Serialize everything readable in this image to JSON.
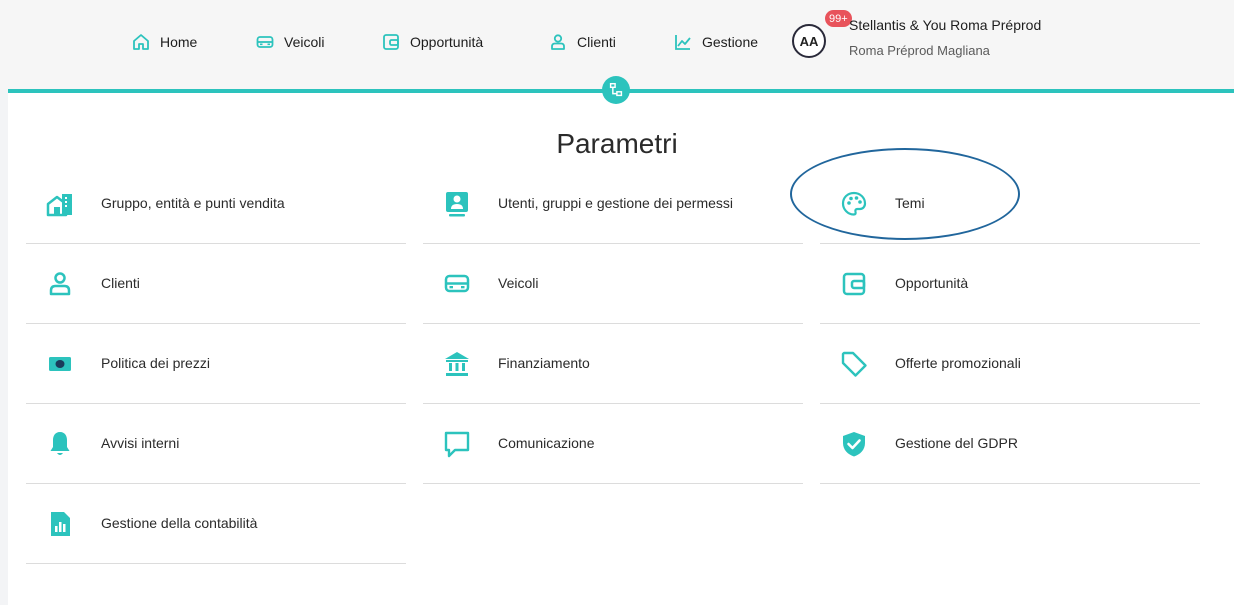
{
  "nav": [
    {
      "label": "Home",
      "icon": "home-icon"
    },
    {
      "label": "Veicoli",
      "icon": "car-icon"
    },
    {
      "label": "Opportunità",
      "icon": "wallet-icon"
    },
    {
      "label": "Clienti",
      "icon": "person-icon"
    },
    {
      "label": "Gestione",
      "icon": "chart-line-icon"
    }
  ],
  "user": {
    "initials": "AA",
    "badge": "99+",
    "name": "Stellantis & You Roma Préprod",
    "location": "Roma Préprod Magliana"
  },
  "page": {
    "title": "Parametri"
  },
  "accent": "#2cc3bd",
  "highlight_color": "#21669c",
  "items": [
    {
      "label": "Gruppo, entità e punti vendita",
      "icon": "buildings-icon"
    },
    {
      "label": "Utenti, gruppi e gestione dei permessi",
      "icon": "user-card-icon"
    },
    {
      "label": "Temi",
      "icon": "palette-icon"
    },
    {
      "label": "Clienti",
      "icon": "person-icon"
    },
    {
      "label": "Veicoli",
      "icon": "car-icon"
    },
    {
      "label": "Opportunità",
      "icon": "wallet-icon"
    },
    {
      "label": "Politica dei prezzi",
      "icon": "banknote-icon"
    },
    {
      "label": "Finanziamento",
      "icon": "bank-icon"
    },
    {
      "label": "Offerte promozionali",
      "icon": "tag-icon"
    },
    {
      "label": "Avvisi interni",
      "icon": "bell-icon"
    },
    {
      "label": "Comunicazione",
      "icon": "chat-icon"
    },
    {
      "label": "Gestione del GDPR",
      "icon": "shield-check-icon"
    },
    {
      "label": "Gestione della contabilità",
      "icon": "report-icon"
    }
  ]
}
